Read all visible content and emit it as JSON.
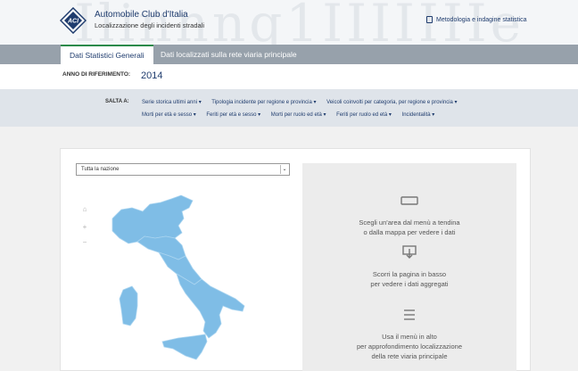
{
  "header": {
    "brand_title": "Automobile Club d'Italia",
    "brand_subtitle": "Localizzazione degli incidenti stradali",
    "logo_text": "ACI",
    "top_link": "Metodologia e indagine statistica",
    "watermark": "Ilinnnq1IIIIIIIe"
  },
  "tabs": [
    {
      "label": "Dati Statistici Generali",
      "active": true
    },
    {
      "label": "Dati localizzati sulla rete viaria principale",
      "active": false
    }
  ],
  "reference": {
    "label": "ANNO DI RIFERIMENTO:",
    "year": "2014"
  },
  "salta": {
    "label": "SALTA A:",
    "row1": [
      "Serie storica ultimi anni ▾",
      "Tipologia incidente per regione e provincia ▾",
      "Veicoli coinvolti per categoria, per regione e provincia ▾"
    ],
    "row2": [
      "Morti per età e sesso ▾",
      "Feriti per età e sesso ▾",
      "Morti per ruolo ed età ▾",
      "Feriti per ruolo ed età ▾",
      "Incidentalità ▾"
    ]
  },
  "map": {
    "select_value": "Tutta la nazione",
    "select_arrow": "⌄",
    "home_icon": "⌂",
    "zoom_in": "+",
    "zoom_out": "−",
    "fill_color": "#7fbde6",
    "stroke_color": "#a9d4f0"
  },
  "info": [
    {
      "icon": "dropdown-icon",
      "lines": [
        "Scegli un'area dal menù a tendina",
        "o dalla mappa per vedere i dati"
      ]
    },
    {
      "icon": "scroll-down-icon",
      "lines": [
        "Scorri la pagina in basso",
        "per vedere i dati aggregati"
      ]
    },
    {
      "icon": "menu-icon",
      "lines": [
        "Usa il menù in alto",
        "per approfondimento localizzazione",
        "della rete viaria principale"
      ]
    }
  ]
}
